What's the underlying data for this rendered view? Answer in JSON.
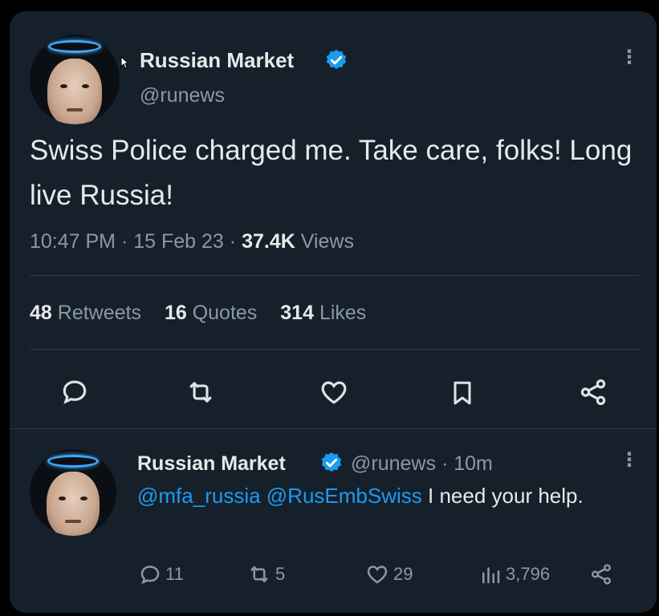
{
  "colors": {
    "background": "#15202b",
    "accent": "#1d9bf0",
    "text": "#e7e9ea",
    "muted": "#8b98a5"
  },
  "tweet": {
    "author_name": "Russian Market",
    "handle": "@runews",
    "text": "Swiss Police charged me. Take care, folks! Long live Russia!",
    "time": "10:47 PM",
    "date": "15 Feb 23",
    "views_count": "37.4K",
    "views_label": "Views",
    "retweets_count": "48",
    "retweets_label": "Retweets",
    "quotes_count": "16",
    "quotes_label": "Quotes",
    "likes_count": "314",
    "likes_label": "Likes",
    "actions": [
      "reply-icon",
      "retweet-icon",
      "like-icon",
      "bookmark-icon",
      "share-icon"
    ]
  },
  "reply": {
    "author_name": "Russian Market",
    "handle": "@runews",
    "time": "10m",
    "mention1": "@mfa_russia",
    "mention2": "@RusEmbSwiss",
    "text_rest": "I need your help.",
    "reply_count": "11",
    "retweet_count": "5",
    "like_count": "29",
    "views_count": "3,796"
  }
}
